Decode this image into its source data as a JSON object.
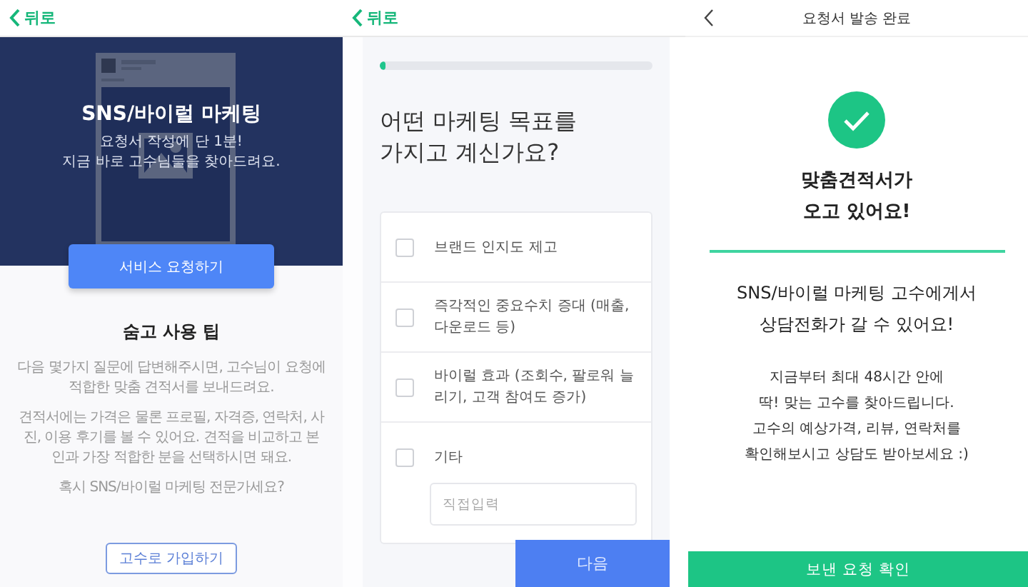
{
  "intro_screen": {
    "back_label": "뒤로",
    "hero": {
      "title": "SNS/바이럴 마케팅",
      "subtitle_lines": [
        "요청서 작성에 단 1분!",
        "지금 바로 고수님들을 찾아드려요."
      ],
      "picture": {
        "kind": "picture"
      }
    },
    "request_button": "서비스 요청하기",
    "tips": {
      "title": "숨고 사용 팁",
      "paragraphs": [
        "다음 몇가지 질문에 답변해주시면, 고수님이 요청에 적합한 맞춤 견적서를 보내드려요.",
        "견적서에는 가격은 물론 프로필, 자격증, 연락처, 사진, 이용 후기를 볼 수 있어요. 견적을 비교하고 본인과 가장 적합한 분을 선택하시면 돼요.",
        "혹시 SNS/바이럴 마케팅 전문가세요?"
      ]
    },
    "join_button": "고수로 가입하기"
  },
  "question_screen": {
    "back_label": "뒤로",
    "progress": {
      "level": 0.02
    },
    "question": "어떤 마케팅 목표를 가지고 계신가요?",
    "options": [
      {
        "kind": "checkbox",
        "label": "브랜드 인지도 제고",
        "checked": false
      },
      {
        "kind": "checkbox",
        "label": "즉각적인 중요수치 증대 (매출, 다운로드 등)",
        "checked": false
      },
      {
        "kind": "checkbox",
        "label": "바이럴 효과 (조회수, 팔로워 늘리기, 고객 참여도 증가)",
        "checked": false
      },
      {
        "kind": "checkbox_with_input",
        "label": "기타",
        "checked": false,
        "placeholder": "직접입력"
      }
    ],
    "next_button": "다음"
  },
  "done_screen": {
    "title": "요청서 발송 완료",
    "headline_lines": [
      "맞춤견적서가",
      "오고 있어요!"
    ],
    "message_lines": [
      "SNS/바이럴 마케팅 고수에게서",
      "상담전화가 갈 수 있어요!"
    ],
    "detail_lines": [
      "지금부터 최대 48시간 안에",
      "딱! 맞는 고수를 찾아드립니다.",
      "고수의 예상가격, 리뷰, 연락처를",
      "확인해보시고 상담도 받아보세요 :)"
    ],
    "confirm_button": "보낸 요청 확인"
  }
}
